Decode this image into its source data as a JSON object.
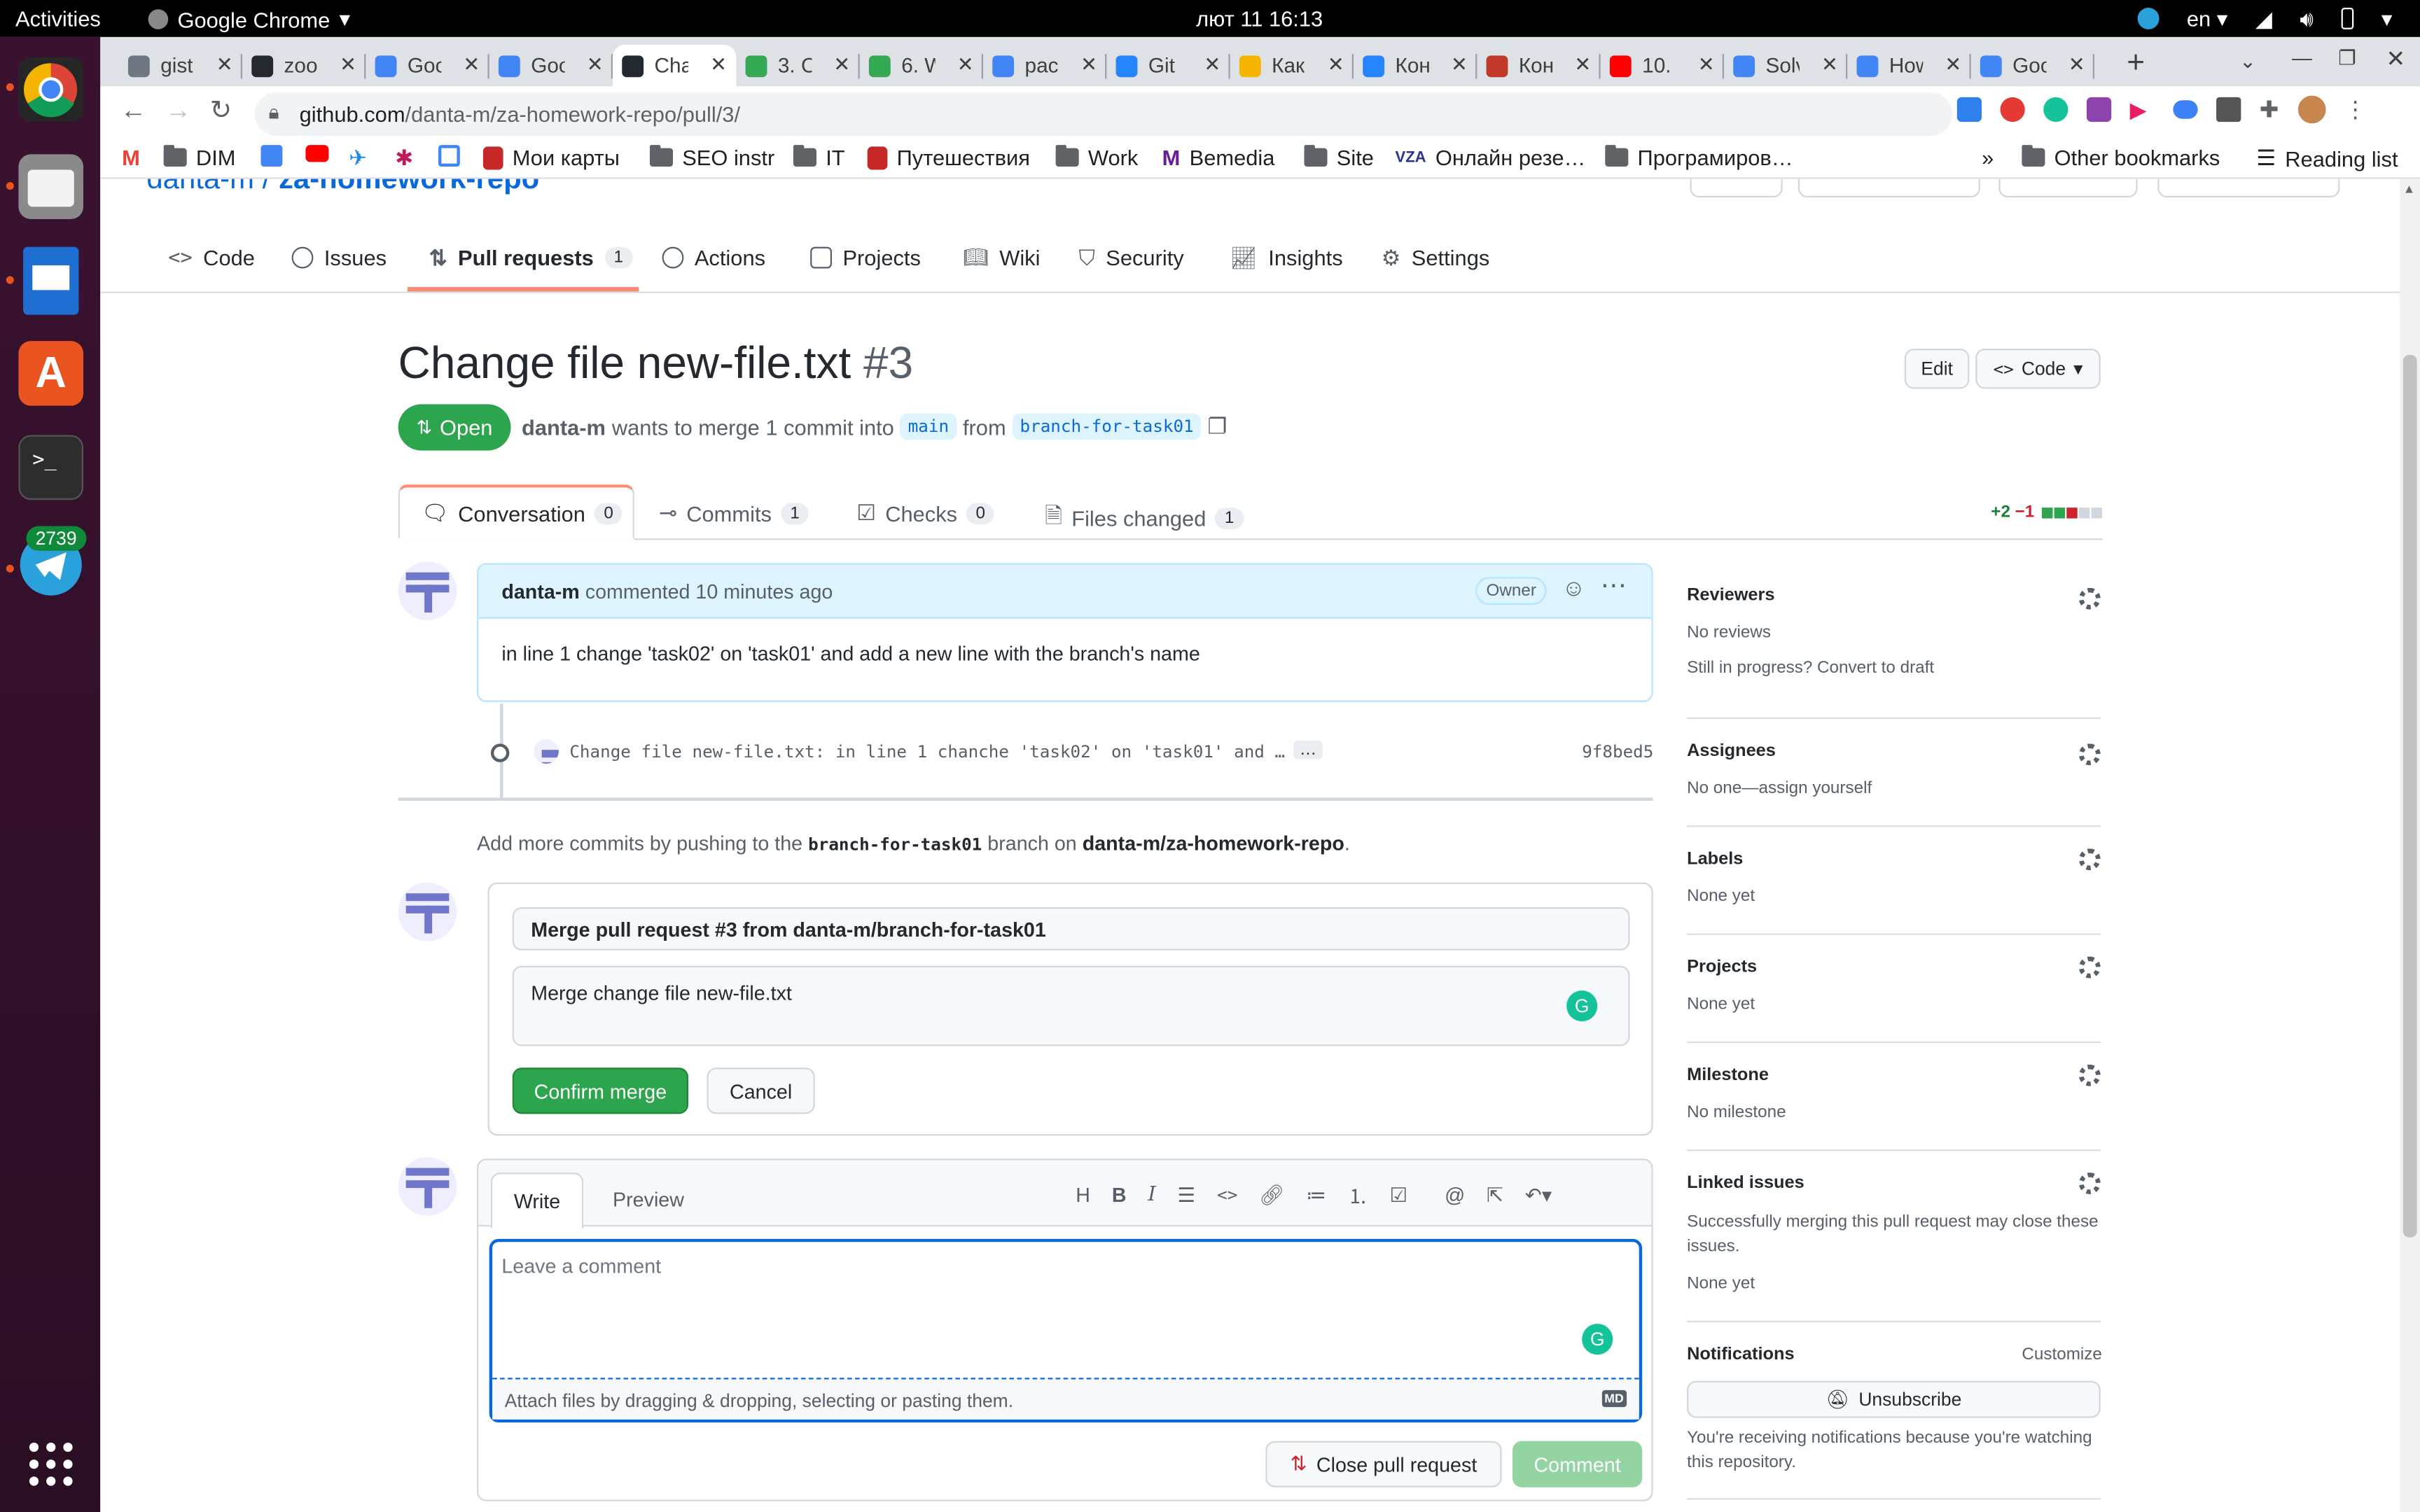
{
  "system": {
    "activities": "Activities",
    "app": "Google Chrome",
    "clock": "лют 11  16:13",
    "lang": "en"
  },
  "dock": {
    "telegram_badge": "2739"
  },
  "tabs": [
    {
      "title": "gist",
      "color": "#6e7681"
    },
    {
      "title": "zoo",
      "color": "#24292f"
    },
    {
      "title": "Goo",
      "color": "#4285f4"
    },
    {
      "title": "Goo",
      "color": "#4285f4"
    },
    {
      "title": "Cha",
      "color": "#24292f"
    },
    {
      "title": "3. C",
      "color": "#34a853"
    },
    {
      "title": "6. W",
      "color": "#34a853"
    },
    {
      "title": "рас",
      "color": "#4285f4"
    },
    {
      "title": "Git",
      "color": "#2684ff"
    },
    {
      "title": "Как",
      "color": "#f4b400"
    },
    {
      "title": "Кон",
      "color": "#2684ff"
    },
    {
      "title": "Кон",
      "color": "#c0392b"
    },
    {
      "title": "10.",
      "color": "#ff0000"
    },
    {
      "title": "Solv",
      "color": "#4285f4"
    },
    {
      "title": "How",
      "color": "#4285f4"
    },
    {
      "title": "Goo",
      "color": "#4285f4"
    }
  ],
  "url": {
    "host": "github.com",
    "path": "/danta-m/za-homework-repo/pull/3/"
  },
  "bookmarks": [
    "DIM",
    "Мои карты",
    "SEO instr",
    "IT",
    "Путешествия",
    "Work",
    "Bemedia",
    "Site",
    "Онлайн резе…",
    "Програмиров…",
    "Other bookmarks",
    "Reading list"
  ],
  "repo": {
    "owner": "danta-m",
    "name": "za-homework-repo"
  },
  "reponav": [
    {
      "label": "Code"
    },
    {
      "label": "Issues"
    },
    {
      "label": "Pull requests",
      "count": "1"
    },
    {
      "label": "Actions"
    },
    {
      "label": "Projects"
    },
    {
      "label": "Wiki"
    },
    {
      "label": "Security"
    },
    {
      "label": "Insights"
    },
    {
      "label": "Settings"
    }
  ],
  "pr": {
    "title": "Change file new-file.txt",
    "number": "#3",
    "state": "Open",
    "author": "danta-m",
    "merge_text": "wants to merge 1 commit into",
    "base": "main",
    "from": "from",
    "head": "branch-for-task01",
    "edit": "Edit",
    "code": "Code"
  },
  "prtabs": [
    {
      "label": "Conversation",
      "count": "0"
    },
    {
      "label": "Commits",
      "count": "1"
    },
    {
      "label": "Checks",
      "count": "0"
    },
    {
      "label": "Files changed",
      "count": "1"
    }
  ],
  "diffstat": {
    "add": "+2",
    "del": "−1"
  },
  "comment": {
    "author": "danta-m",
    "meta": "commented 10 minutes ago",
    "badge": "Owner",
    "body": "in line 1 change 'task02' on 'task01' and add a new line with the branch's name"
  },
  "commit": {
    "message": "Change file new-file.txt: in line 1 chanche 'task02' on 'task01' and …",
    "more": "…",
    "sha": "9f8bed5"
  },
  "hint": {
    "pre": "Add more commits by pushing to the",
    "branch": "branch-for-task01",
    "mid": "branch on",
    "repo": "danta-m/za-homework-repo",
    "post": "."
  },
  "merge": {
    "title": "Merge pull request #3 from danta-m/branch-for-task01",
    "body": "Merge change file new-file.txt",
    "confirm": "Confirm merge",
    "cancel": "Cancel"
  },
  "editor": {
    "write": "Write",
    "preview": "Preview",
    "placeholder": "Leave a comment",
    "attach": "Attach files by dragging & dropping, selecting or pasting them.",
    "md": "MD",
    "close": "Close pull request",
    "submit": "Comment"
  },
  "sidebar": {
    "reviewers": {
      "h": "Reviewers",
      "t1": "No reviews",
      "t2": "Still in progress? Convert to draft"
    },
    "assignees": {
      "h": "Assignees",
      "t": "No one—assign yourself"
    },
    "labels": {
      "h": "Labels",
      "t": "None yet"
    },
    "projects": {
      "h": "Projects",
      "t": "None yet"
    },
    "milestone": {
      "h": "Milestone",
      "t": "No milestone"
    },
    "linked": {
      "h": "Linked issues",
      "t1": "Successfully merging this pull request may close these issues.",
      "t2": "None yet"
    },
    "notif": {
      "h": "Notifications",
      "customize": "Customize",
      "unsub": "Unsubscribe",
      "t": "You're receiving notifications because you're watching this repository."
    }
  }
}
